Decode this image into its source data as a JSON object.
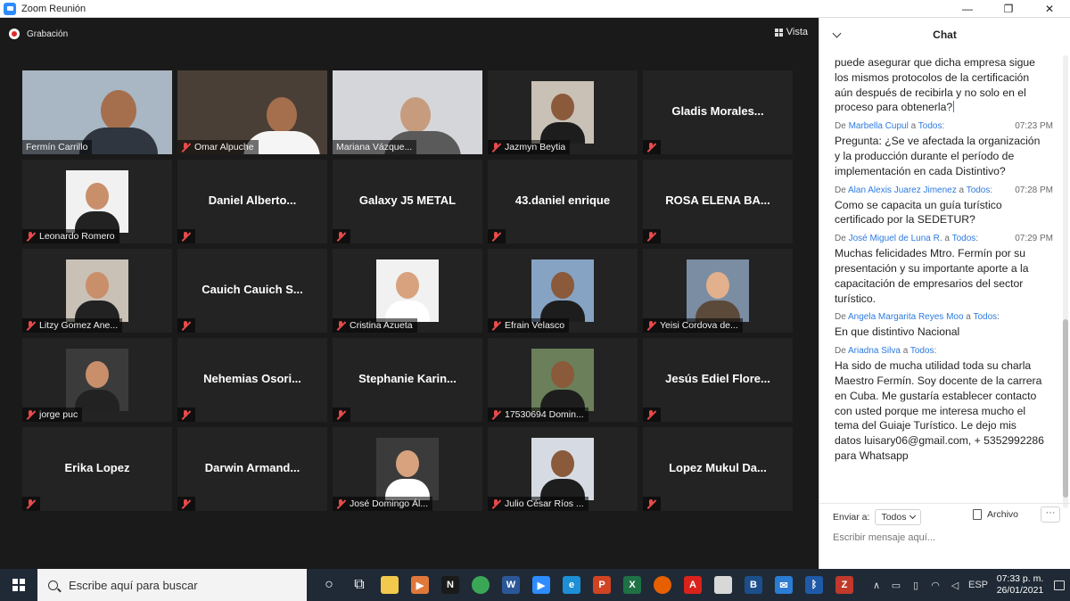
{
  "window": {
    "title": "Zoom Reunión",
    "minimize": "—",
    "maximize": "❐",
    "close": "✕"
  },
  "meeting": {
    "recording_label": "Grabación",
    "view_label": "Vista",
    "participants": [
      {
        "name": "Fermín Carrillo",
        "video": true,
        "muted": false,
        "active": true
      },
      {
        "name": "Omar Alpuche",
        "video": true,
        "muted": true
      },
      {
        "name": "Mariana Vázque...",
        "video": true,
        "muted": false
      },
      {
        "name": "Jazmyn Beytia",
        "photo": true,
        "muted": true
      },
      {
        "center": "Gladis  Morales...",
        "muted": true
      },
      {
        "name": "Leonardo Romero",
        "photo": true,
        "muted": true
      },
      {
        "center": "Daniel  Alberto...",
        "muted": true
      },
      {
        "center": "Galaxy J5 METAL",
        "muted": true
      },
      {
        "center": "43.daniel enrique",
        "muted": true
      },
      {
        "center": "ROSA ELENA BA...",
        "muted": true
      },
      {
        "name": "Litzy Gomez Ane...",
        "photo": true,
        "muted": true
      },
      {
        "center": "Cauich  Cauich  S...",
        "muted": true
      },
      {
        "name": "Cristina Azueta",
        "photo": true,
        "muted": true
      },
      {
        "name": "Efrain Velasco",
        "photo": true,
        "muted": true
      },
      {
        "name": "Yeisi Cordova de...",
        "photo": true,
        "muted": true
      },
      {
        "name": "jorge puc",
        "photo": true,
        "muted": true
      },
      {
        "center": "Nehemias  Osori...",
        "muted": true
      },
      {
        "center": "Stephanie  Karin...",
        "muted": true
      },
      {
        "name": "17530694 Domin...",
        "photo": true,
        "muted": true
      },
      {
        "center": "Jesús  Ediel  Flore...",
        "muted": true
      },
      {
        "center": "Erika Lopez",
        "muted": true
      },
      {
        "center": "Darwin  Armand...",
        "muted": true
      },
      {
        "name": "José Domingo Ál...",
        "photo": true,
        "muted": true
      },
      {
        "name": "Julio César Ríos ...",
        "photo": true,
        "muted": true
      },
      {
        "center": "Lopez  Mukul  Da...",
        "muted": true
      }
    ]
  },
  "chat": {
    "title": "Chat",
    "partial_message": "puede asegurar que dicha empresa sigue los mismos protocolos de la certificación aún después de recibirla y no solo en el proceso para obtenerla?",
    "messages": [
      {
        "prefix": "De ",
        "sender": "Marbella Cupul",
        "to_word": " a ",
        "to": "Todos",
        "colon": ":",
        "time": "07:23 PM",
        "text": "Pregunta: ¿Se ve afectada la organización y la producción durante el período de implementación en cada Distintivo?"
      },
      {
        "prefix": "De ",
        "sender": "Alan Alexis Juarez Jimenez",
        "to_word": " a ",
        "to": "Todos",
        "colon": ":",
        "time": "07:28 PM",
        "text": "Como se capacita un guía turístico certificado por la SEDETUR?"
      },
      {
        "prefix": "De ",
        "sender": "José Miguel de Luna R.",
        "to_word": " a ",
        "to": "Todos",
        "colon": ":",
        "time": "07:29 PM",
        "text": "Muchas felicidades Mtro. Fermín por su presentación y su importante aporte a la capacitación de empresarios del sector turístico."
      },
      {
        "prefix": "De ",
        "sender": "Angela Margarita Reyes Moo",
        "to_word": " a ",
        "to": "Todos",
        "colon": ":",
        "time": "",
        "text": "En que distintivo Nacional"
      },
      {
        "prefix": "De ",
        "sender": "Ariadna Silva",
        "to_word": " a ",
        "to": "Todos",
        "colon": ":",
        "time": "",
        "text": "Ha sido de mucha utilidad toda su charla Maestro Fermín. Soy docente de la carrera en Cuba. Me gustaría establecer contacto con usted porque me interesa mucho el tema del Guiaje Turístico. Le dejo mis datos luisary06@gmail.com, + 5352992286 para Whatsapp"
      }
    ],
    "send_to_label": "Enviar a:",
    "send_to_value": "Todos",
    "file_label": "Archivo",
    "more_label": "···",
    "input_placeholder": "Escribir mensaje aquí..."
  },
  "taskbar": {
    "search_placeholder": "Escribe aquí para buscar",
    "apps": [
      {
        "name": "cortana-icon",
        "label": "○",
        "color": "transparent"
      },
      {
        "name": "task-view-icon",
        "label": "⧉",
        "color": "transparent"
      },
      {
        "name": "file-explorer-icon",
        "label": "",
        "color": "#f2c94c"
      },
      {
        "name": "media-player-icon",
        "label": "▶",
        "color": "#e0783a"
      },
      {
        "name": "netflix-icon",
        "label": "N",
        "color": "#1a1a1a"
      },
      {
        "name": "chrome-icon",
        "label": "",
        "color": "#3aa757"
      },
      {
        "name": "word-icon",
        "label": "W",
        "color": "#2b5797"
      },
      {
        "name": "zoom-icon",
        "label": "▶",
        "color": "#2d8cff"
      },
      {
        "name": "edge-icon",
        "label": "e",
        "color": "#1c8fd6"
      },
      {
        "name": "powerpoint-icon",
        "label": "P",
        "color": "#d04423"
      },
      {
        "name": "excel-icon",
        "label": "X",
        "color": "#1e7145"
      },
      {
        "name": "firefox-icon",
        "label": "",
        "color": "#e66000"
      },
      {
        "name": "acrobat-icon",
        "label": "A",
        "color": "#d9221c"
      },
      {
        "name": "store-icon",
        "label": "",
        "color": "#d8d8d8"
      },
      {
        "name": "bluebeam-icon",
        "label": "B",
        "color": "#1c4f8a"
      },
      {
        "name": "mail-icon",
        "label": "✉",
        "color": "#2b7cd3"
      },
      {
        "name": "bluetooth-icon",
        "label": "ᛒ",
        "color": "#1e5aa8"
      },
      {
        "name": "zoom-active-icon",
        "label": "Z",
        "color": "#c0392b"
      }
    ],
    "tray": {
      "chevron": "∧",
      "lang": "ESP",
      "time": "07:33 p. m.",
      "date": "26/01/2021"
    }
  }
}
